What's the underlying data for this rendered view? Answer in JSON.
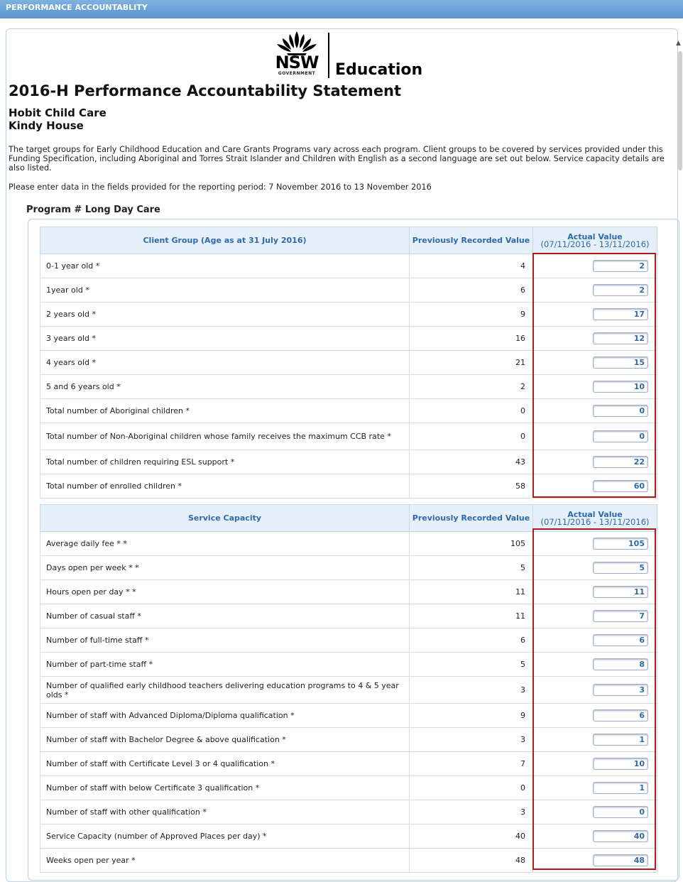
{
  "header": {
    "title": "PERFORMANCE ACCOUNTABLITY"
  },
  "logo": {
    "nsw": "NSW",
    "government": "GOVERNMENT",
    "department": "Education"
  },
  "statement_title": "2016-H Performance Accountability Statement",
  "organisation": {
    "name": "Hobit Child Care",
    "service": "Kindy House"
  },
  "intro_text": "The target groups for Early Childhood Education and Care Grants Programs vary across each program. Client groups to be covered by services provided under this Funding Specification, including Aboriginal and Torres Strait Islander and Children with English as a second language are set out below. Service capacity details are also listed.",
  "period_text": "Please enter data in the fields provided for the reporting period: 7 November 2016  to 13 November 2016",
  "program_title": "Program # Long Day Care",
  "client_table": {
    "headers": [
      "Client Group (Age as at 31 July 2016)",
      "Previously Recorded Value",
      "Actual Value",
      "(07/11/2016 - 13/11/2016)"
    ],
    "rows": [
      {
        "label": "0-1 year old *",
        "prev": "4",
        "actual": "2"
      },
      {
        "label": "1year old *",
        "prev": "6",
        "actual": "2"
      },
      {
        "label": "2 years old *",
        "prev": "9",
        "actual": "17"
      },
      {
        "label": "3 years old *",
        "prev": "16",
        "actual": "12"
      },
      {
        "label": "4 years old *",
        "prev": "21",
        "actual": "15"
      },
      {
        "label": "5 and 6 years old *",
        "prev": "2",
        "actual": "10"
      },
      {
        "label": "Total number of Aboriginal children *",
        "prev": "0",
        "actual": "0"
      },
      {
        "label": "Total number of Non-Aboriginal children whose family receives the maximum CCB rate *",
        "prev": "0",
        "actual": "0"
      },
      {
        "label": "Total number of children requiring ESL support *",
        "prev": "43",
        "actual": "22"
      },
      {
        "label": "Total number of enrolled children *",
        "prev": "58",
        "actual": "60"
      }
    ]
  },
  "capacity_table": {
    "headers": [
      "Service Capacity",
      "Previously Recorded Value",
      "Actual Value",
      "(07/11/2016 - 13/11/2016)"
    ],
    "rows": [
      {
        "label": "Average daily fee * *",
        "prev": "105",
        "actual": "105"
      },
      {
        "label": "Days open per week * *",
        "prev": "5",
        "actual": "5"
      },
      {
        "label": "Hours open per day * *",
        "prev": "11",
        "actual": "11"
      },
      {
        "label": "Number of casual staff *",
        "prev": "11",
        "actual": "7"
      },
      {
        "label": "Number of full-time staff *",
        "prev": "6",
        "actual": "6"
      },
      {
        "label": "Number of part-time staff *",
        "prev": "5",
        "actual": "8"
      },
      {
        "label": "Number of qualified early childhood teachers delivering education programs to 4 & 5 year olds *",
        "prev": "3",
        "actual": "3"
      },
      {
        "label": "Number of staff with Advanced Diploma/Diploma qualification *",
        "prev": "9",
        "actual": "6"
      },
      {
        "label": "Number of staff with Bachelor Degree & above qualification *",
        "prev": "3",
        "actual": "1"
      },
      {
        "label": "Number of staff with Certificate Level 3 or 4 qualification *",
        "prev": "7",
        "actual": "10"
      },
      {
        "label": "Number of staff with below Certificate 3 qualification *",
        "prev": "0",
        "actual": "1"
      },
      {
        "label": "Number of staff with other qualification *",
        "prev": "3",
        "actual": "0"
      },
      {
        "label": "Service Capacity (number of Approved Places per day) *",
        "prev": "40",
        "actual": "40"
      },
      {
        "label": "Weeks open per year *",
        "prev": "48",
        "actual": "48"
      }
    ]
  }
}
